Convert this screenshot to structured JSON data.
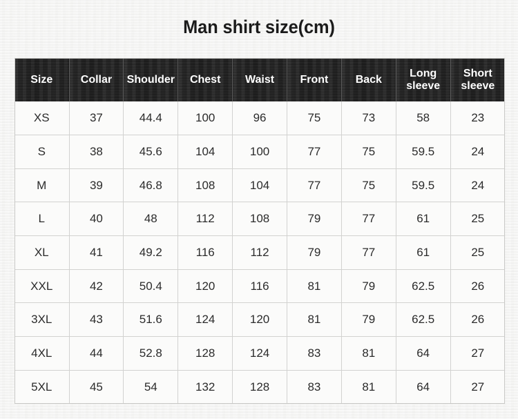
{
  "title": "Man shirt size(cm)",
  "colors": {
    "page_background": "#f5f5f4",
    "header_background": "#282828",
    "header_text": "#ffffff",
    "cell_background": "#fbfbfa",
    "cell_text": "#2b2b2b",
    "grid_line": "#d2d2d0",
    "title_text": "#1b1b1b"
  },
  "table": {
    "columns": [
      "Size",
      "Collar",
      "Shoulder",
      "Chest",
      "Waist",
      "Front",
      "Back",
      "Long sleeve",
      "Short sleeve"
    ],
    "rows": [
      {
        "size": "XS",
        "collar": "37",
        "shoulder": "44.4",
        "chest": "100",
        "waist": "96",
        "front": "75",
        "back": "73",
        "long_sleeve": "58",
        "short_sleeve": "23"
      },
      {
        "size": "S",
        "collar": "38",
        "shoulder": "45.6",
        "chest": "104",
        "waist": "100",
        "front": "77",
        "back": "75",
        "long_sleeve": "59.5",
        "short_sleeve": "24"
      },
      {
        "size": "M",
        "collar": "39",
        "shoulder": "46.8",
        "chest": "108",
        "waist": "104",
        "front": "77",
        "back": "75",
        "long_sleeve": "59.5",
        "short_sleeve": "24"
      },
      {
        "size": "L",
        "collar": "40",
        "shoulder": "48",
        "chest": "112",
        "waist": "108",
        "front": "79",
        "back": "77",
        "long_sleeve": "61",
        "short_sleeve": "25"
      },
      {
        "size": "XL",
        "collar": "41",
        "shoulder": "49.2",
        "chest": "116",
        "waist": "112",
        "front": "79",
        "back": "77",
        "long_sleeve": "61",
        "short_sleeve": "25"
      },
      {
        "size": "XXL",
        "collar": "42",
        "shoulder": "50.4",
        "chest": "120",
        "waist": "116",
        "front": "81",
        "back": "79",
        "long_sleeve": "62.5",
        "short_sleeve": "26"
      },
      {
        "size": "3XL",
        "collar": "43",
        "shoulder": "51.6",
        "chest": "124",
        "waist": "120",
        "front": "81",
        "back": "79",
        "long_sleeve": "62.5",
        "short_sleeve": "26"
      },
      {
        "size": "4XL",
        "collar": "44",
        "shoulder": "52.8",
        "chest": "128",
        "waist": "124",
        "front": "83",
        "back": "81",
        "long_sleeve": "64",
        "short_sleeve": "27"
      },
      {
        "size": "5XL",
        "collar": "45",
        "shoulder": "54",
        "chest": "132",
        "waist": "128",
        "front": "83",
        "back": "81",
        "long_sleeve": "64",
        "short_sleeve": "27"
      }
    ]
  }
}
